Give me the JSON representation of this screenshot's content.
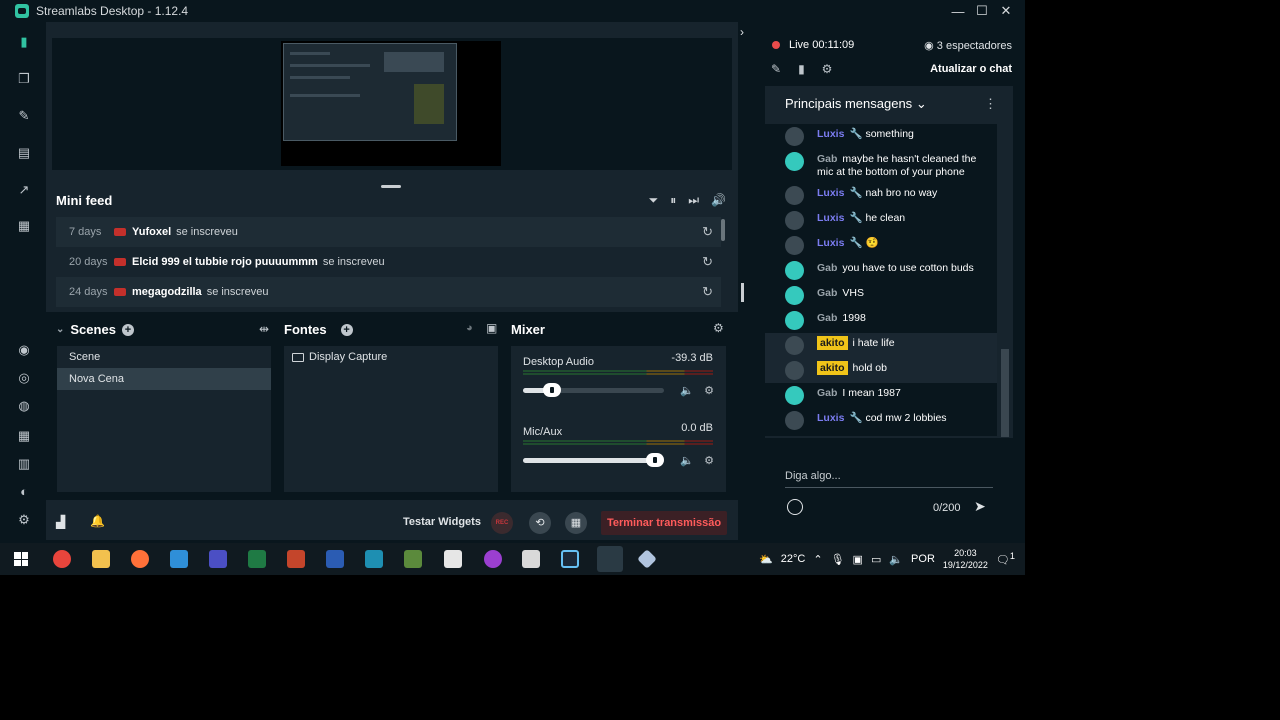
{
  "window": {
    "title": "Streamlabs Desktop - 1.12.4",
    "minimize": "—",
    "maximize": "☐",
    "close": "✕"
  },
  "sidebar": {
    "icons": [
      "studio-icon",
      "layers-icon",
      "themes-icon",
      "store-icon",
      "stats-icon",
      "editor-icon",
      "widget-icon",
      "alert-icon",
      "tips-icon",
      "grid-icon",
      "columns-icon",
      "face-icon",
      "settings-icon"
    ]
  },
  "feed": {
    "title": "Mini feed",
    "tools": [
      "⏷",
      "⏸",
      "⏭",
      "🔊"
    ],
    "rows": [
      {
        "age": "7 days",
        "user": "Yufoxel",
        "action": "se inscreveu"
      },
      {
        "age": "20 days",
        "user": "Elcid 999 el tubbie rojo puuuummm",
        "action": "se inscreveu"
      },
      {
        "age": "24 days",
        "user": "megagodzilla",
        "action": "se inscreveu"
      }
    ]
  },
  "scenes": {
    "title": "Scenes",
    "items": [
      "Scene",
      "Nova Cena"
    ],
    "active_index": 1
  },
  "sources": {
    "title": "Fontes",
    "items": [
      "Display Capture"
    ]
  },
  "mixer": {
    "title": "Mixer",
    "channels": [
      {
        "name": "Desktop Audio",
        "db": "-39.3 dB",
        "level": 0.16
      },
      {
        "name": "Mic/Aux",
        "db": "0.0 dB",
        "level": 1.0
      }
    ]
  },
  "footer": {
    "test_widgets": "Testar Widgets",
    "rec": "REC",
    "end_stream": "Terminar transmissão"
  },
  "chat": {
    "live_label": "Live",
    "live_time": "00:11:09",
    "viewers": "3 espectadores",
    "refresh": "Atualizar o chat",
    "header": "Principais mensagens",
    "input_placeholder": "Diga algo...",
    "char_count": "0/200",
    "messages": [
      {
        "user": "Luxis",
        "type": "luxis",
        "text": "something"
      },
      {
        "user": "Gab",
        "type": "gab",
        "text": "maybe he hasn't cleaned the mic at the bottom of your phone"
      },
      {
        "user": "Luxis",
        "type": "luxis",
        "text": "nah bro no way"
      },
      {
        "user": "Luxis",
        "type": "luxis",
        "text": "he clean"
      },
      {
        "user": "Luxis",
        "type": "luxis",
        "text": "🤨"
      },
      {
        "user": "Gab",
        "type": "gab",
        "text": "you have to use cotton buds"
      },
      {
        "user": "Gab",
        "type": "gab",
        "text": "VHS"
      },
      {
        "user": "Gab",
        "type": "gab",
        "text": "1998"
      },
      {
        "user": "akito",
        "type": "akito",
        "text": "i hate life"
      },
      {
        "user": "akito",
        "type": "akito",
        "text": "hold ob"
      },
      {
        "user": "Gab",
        "type": "gab",
        "text": "I mean 1987"
      },
      {
        "user": "Luxis",
        "type": "luxis",
        "text": "cod mw 2 lobbies"
      }
    ]
  },
  "taskbar": {
    "weather": "22°C",
    "lang": "POR",
    "time": "20:03",
    "date": "19/12/2022",
    "notif_count": "1"
  },
  "colors": {
    "accent": "#31c3a2",
    "bg": "#09161d",
    "panel": "#17242d",
    "danger": "#ff5b5b",
    "luxis": "#7b7cf0",
    "akito": "#f0c419"
  }
}
